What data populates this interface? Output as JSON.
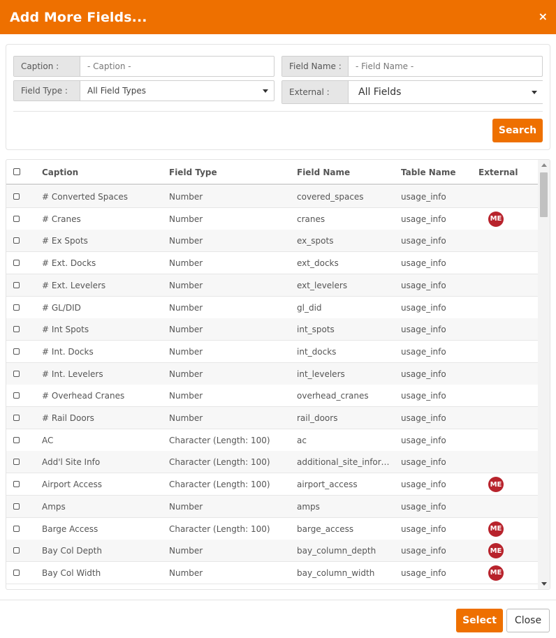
{
  "dialog": {
    "title": "Add More Fields...",
    "close_icon": "×"
  },
  "filters": {
    "caption": {
      "label": "Caption :",
      "placeholder": "- Caption -"
    },
    "field_name": {
      "label": "Field Name :",
      "placeholder": "- Field Name -"
    },
    "field_type": {
      "label": "Field Type :",
      "value": "All Field Types"
    },
    "external": {
      "label": "External :",
      "value": "All Fields"
    },
    "search_label": "Search"
  },
  "table": {
    "columns": [
      "Caption",
      "Field Type",
      "Field Name",
      "Table Name",
      "External"
    ],
    "rows": [
      {
        "caption": "# Converted Spaces",
        "type": "Number",
        "name": "covered_spaces",
        "table": "usage_info",
        "external": ""
      },
      {
        "caption": "# Cranes",
        "type": "Number",
        "name": "cranes",
        "table": "usage_info",
        "external": "ME"
      },
      {
        "caption": "# Ex Spots",
        "type": "Number",
        "name": "ex_spots",
        "table": "usage_info",
        "external": ""
      },
      {
        "caption": "# Ext. Docks",
        "type": "Number",
        "name": "ext_docks",
        "table": "usage_info",
        "external": ""
      },
      {
        "caption": "# Ext. Levelers",
        "type": "Number",
        "name": "ext_levelers",
        "table": "usage_info",
        "external": ""
      },
      {
        "caption": "# GL/DID",
        "type": "Number",
        "name": "gl_did",
        "table": "usage_info",
        "external": ""
      },
      {
        "caption": "# Int Spots",
        "type": "Number",
        "name": "int_spots",
        "table": "usage_info",
        "external": ""
      },
      {
        "caption": "# Int. Docks",
        "type": "Number",
        "name": "int_docks",
        "table": "usage_info",
        "external": ""
      },
      {
        "caption": "# Int. Levelers",
        "type": "Number",
        "name": "int_levelers",
        "table": "usage_info",
        "external": ""
      },
      {
        "caption": "# Overhead Cranes",
        "type": "Number",
        "name": "overhead_cranes",
        "table": "usage_info",
        "external": ""
      },
      {
        "caption": "# Rail Doors",
        "type": "Number",
        "name": "rail_doors",
        "table": "usage_info",
        "external": ""
      },
      {
        "caption": "AC",
        "type": "Character (Length: 100)",
        "name": "ac",
        "table": "usage_info",
        "external": ""
      },
      {
        "caption": "Add'l Site Info",
        "type": "Character (Length: 100)",
        "name": "additional_site_informat...",
        "table": "usage_info",
        "external": ""
      },
      {
        "caption": "Airport Access",
        "type": "Character (Length: 100)",
        "name": "airport_access",
        "table": "usage_info",
        "external": "ME"
      },
      {
        "caption": "Amps",
        "type": "Number",
        "name": "amps",
        "table": "usage_info",
        "external": ""
      },
      {
        "caption": "Barge Access",
        "type": "Character (Length: 100)",
        "name": "barge_access",
        "table": "usage_info",
        "external": "ME"
      },
      {
        "caption": "Bay Col Depth",
        "type": "Number",
        "name": "bay_column_depth",
        "table": "usage_info",
        "external": "ME"
      },
      {
        "caption": "Bay Col Width",
        "type": "Number",
        "name": "bay_column_width",
        "table": "usage_info",
        "external": "ME"
      }
    ]
  },
  "footer": {
    "select_label": "Select",
    "close_label": "Close"
  },
  "colors": {
    "accent": "#ee7000",
    "badge": "#b8232c"
  }
}
